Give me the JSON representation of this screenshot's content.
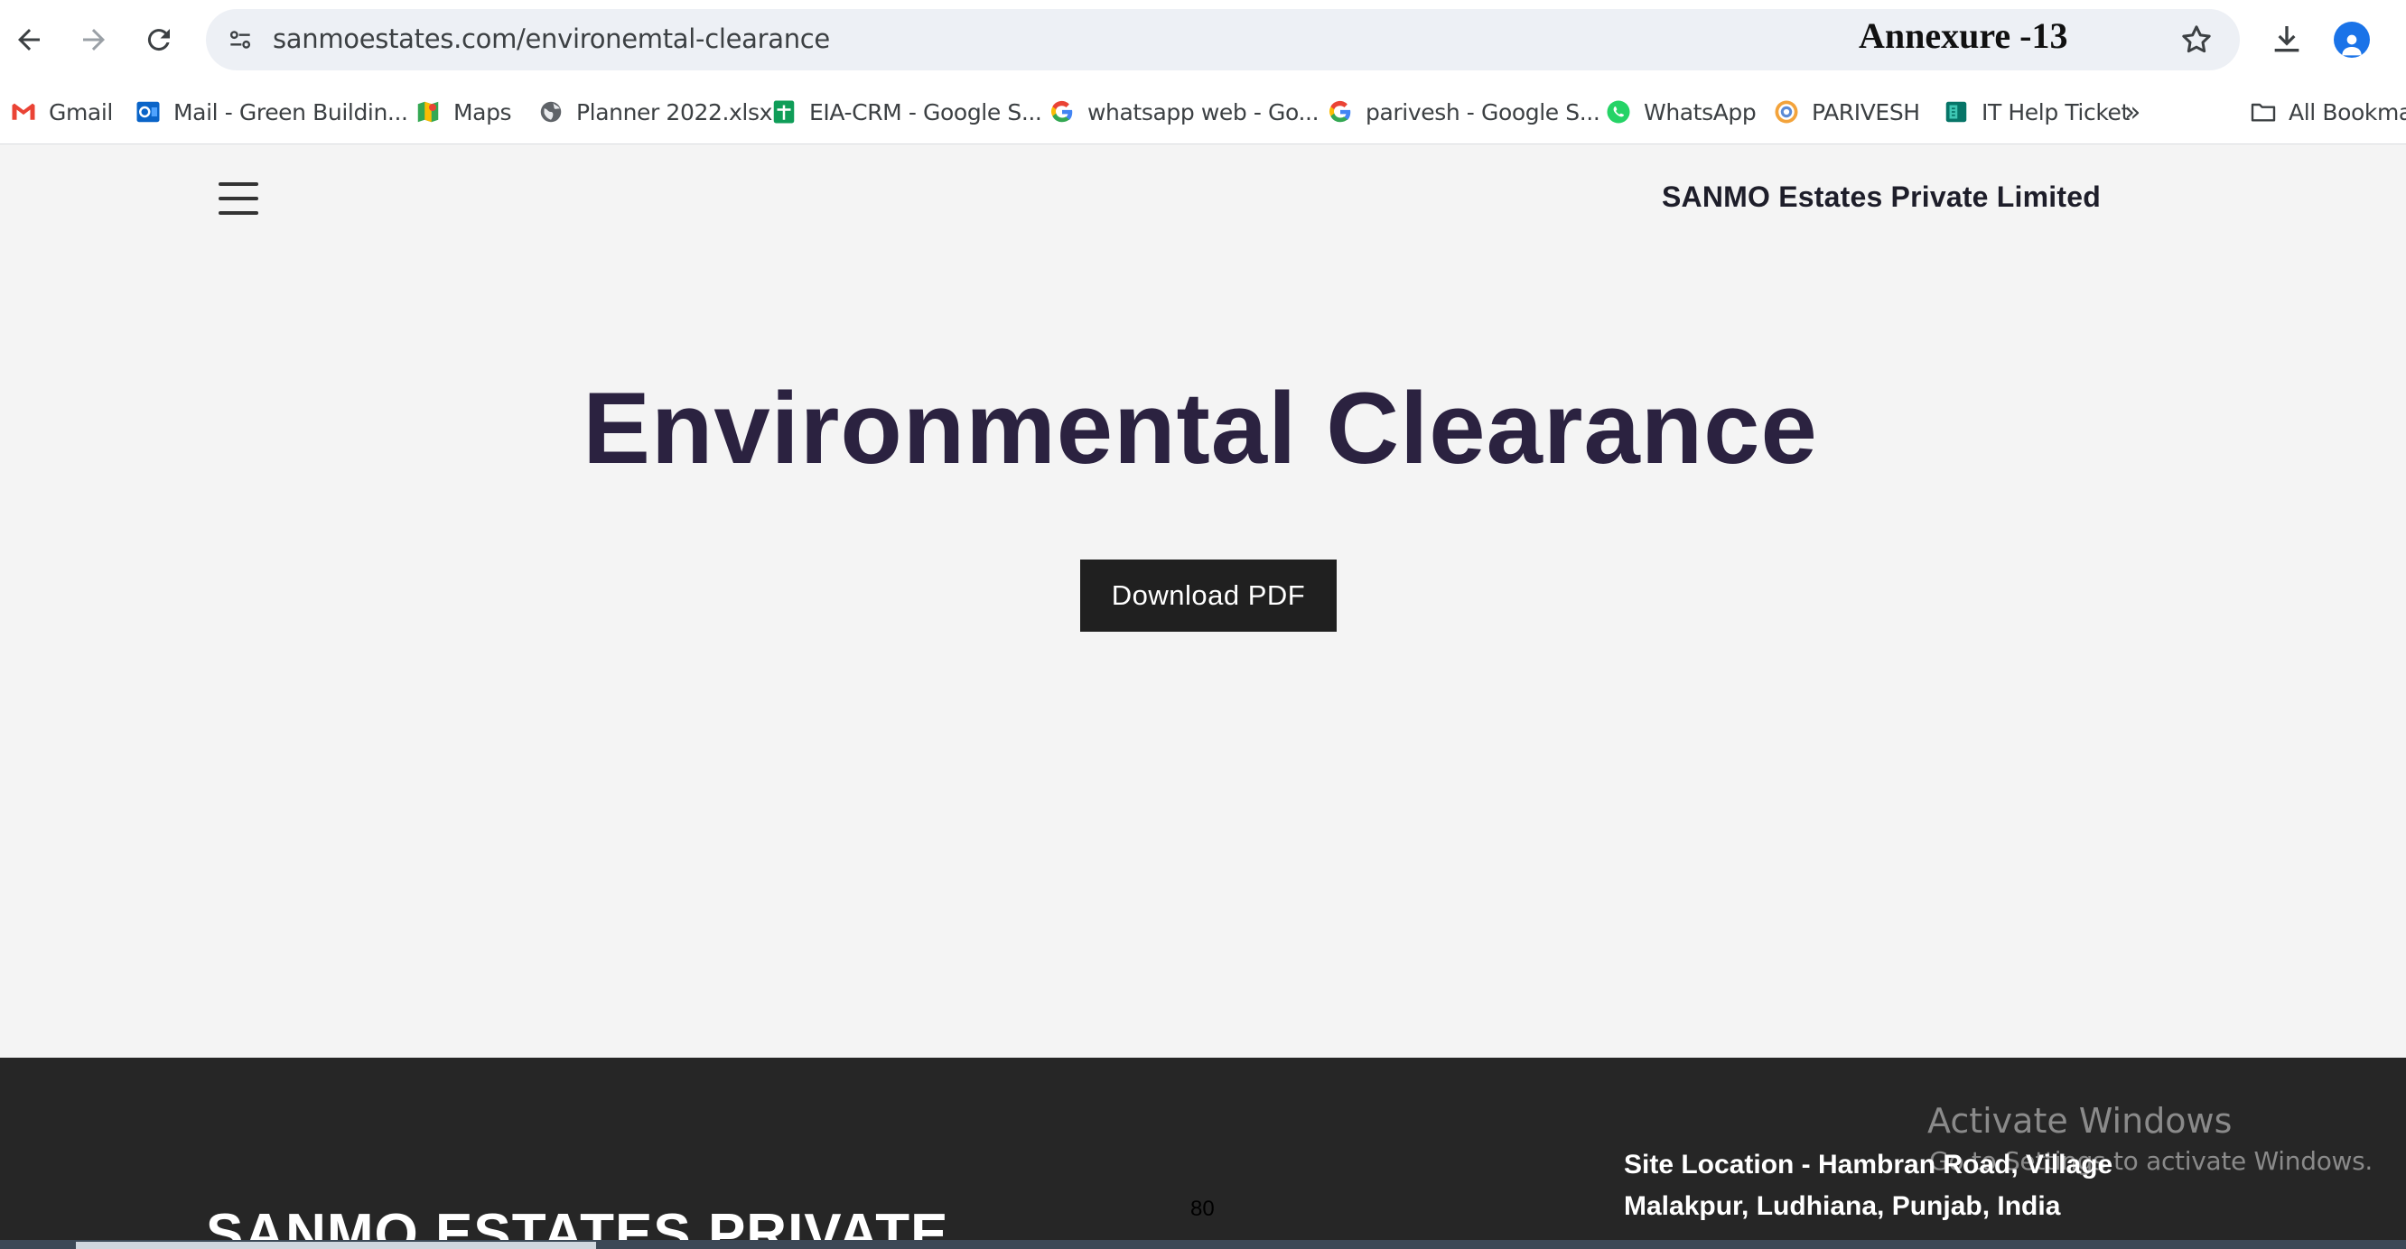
{
  "browser": {
    "url": "sanmoestates.com/environemtal-clearance",
    "annexure_label": "Annexure -13",
    "bookmarks": [
      {
        "label": "Gmail",
        "icon": "gmail-icon"
      },
      {
        "label": "Mail - Green Buildin...",
        "icon": "outlook-icon"
      },
      {
        "label": "Maps",
        "icon": "maps-icon"
      },
      {
        "label": "Planner 2022.xlsx",
        "icon": "globe-icon"
      },
      {
        "label": "EIA-CRM - Google S...",
        "icon": "sheets-icon"
      },
      {
        "label": "whatsapp web - Go...",
        "icon": "google-icon"
      },
      {
        "label": "parivesh - Google S...",
        "icon": "google-icon"
      },
      {
        "label": "WhatsApp",
        "icon": "whatsapp-icon"
      },
      {
        "label": "PARIVESH",
        "icon": "parivesh-icon"
      },
      {
        "label": "IT Help Ticket",
        "icon": "forms-icon"
      }
    ],
    "overflow_label": "»",
    "all_bookmarks_label": "All Bookmarks"
  },
  "header": {
    "brand": "SANMO Estates Private Limited"
  },
  "hero": {
    "title": "Environmental Clearance",
    "download_label": "Download PDF"
  },
  "footer": {
    "company_name": "SANMO ESTATES PRIVATE",
    "site_location": "Site Location - Hambran Road, Village Malakpur, Ludhiana, Punjab, India",
    "page_number": "80"
  },
  "watermark": {
    "title": "Activate Windows",
    "subtitle": "Go to Settings to activate Windows."
  },
  "colors": {
    "hero_title": "#2b2240",
    "button_bg": "#202020",
    "footer_bg": "#262626",
    "page_bg": "#f4f4f4"
  }
}
